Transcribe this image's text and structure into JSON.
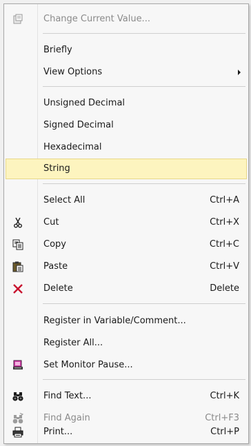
{
  "menu": {
    "items": [
      {
        "label": "Change Current Value...",
        "icon": "edit-value-icon",
        "disabled": true
      },
      {
        "label": "Briefly"
      },
      {
        "label": "View Options",
        "submenu": true
      },
      {
        "label": "Unsigned Decimal"
      },
      {
        "label": "Signed Decimal"
      },
      {
        "label": "Hexadecimal"
      },
      {
        "label": "String",
        "highlighted": true
      },
      {
        "label": "Select All",
        "shortcut": "Ctrl+A"
      },
      {
        "label": "Cut",
        "shortcut": "Ctrl+X",
        "icon": "scissors-icon"
      },
      {
        "label": "Copy",
        "shortcut": "Ctrl+C",
        "icon": "copy-icon"
      },
      {
        "label": "Paste",
        "shortcut": "Ctrl+V",
        "icon": "paste-icon"
      },
      {
        "label": "Delete",
        "shortcut": "Delete",
        "icon": "delete-x-icon"
      },
      {
        "label": "Register in Variable/Comment..."
      },
      {
        "label": "Register All..."
      },
      {
        "label": "Set Monitor Pause...",
        "icon": "monitor-pause-icon"
      },
      {
        "label": "Find Text...",
        "shortcut": "Ctrl+K",
        "icon": "binoculars-icon"
      },
      {
        "label": "Find Again",
        "shortcut": "Ctrl+F3",
        "icon": "find-again-icon",
        "disabled": true
      },
      {
        "label": "Print...",
        "shortcut": "Ctrl+P",
        "icon": "printer-icon"
      }
    ]
  },
  "colors": {
    "menu_background": "#f7f7f7",
    "highlight_background": "#fdf4bf",
    "disabled_text": "#8a8a8a",
    "delete_icon": "#c8102e"
  }
}
